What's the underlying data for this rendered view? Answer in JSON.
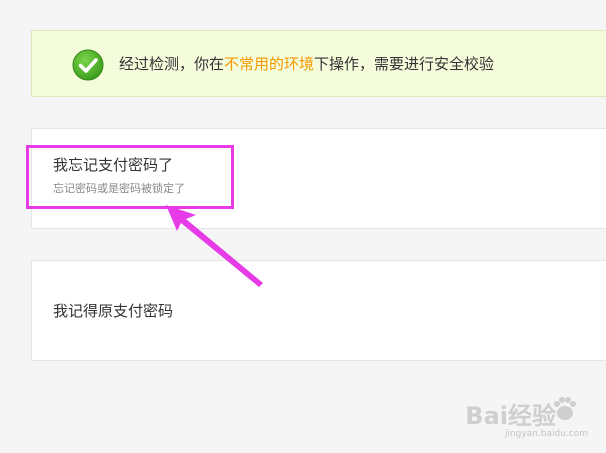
{
  "notice": {
    "text_before": "经过检测，你在",
    "text_highlight": "不常用的环境",
    "text_after": "下操作，需要进行安全校验",
    "icon": "check-circle-icon",
    "highlight_color": "#f39800"
  },
  "options": {
    "forgot": {
      "title": "我忘记支付密码了",
      "subtitle": "忘记密码或是密码被锁定了"
    },
    "remember": {
      "title": "我记得原支付密码"
    }
  },
  "annotation": {
    "color": "#e63be6"
  },
  "watermark": {
    "brand": "Bai经验",
    "url": "jingyan.baidu.com"
  }
}
